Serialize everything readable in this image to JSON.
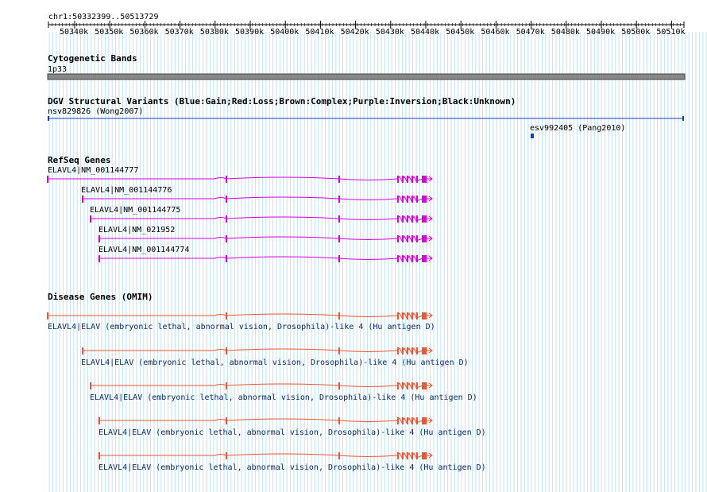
{
  "ruler": {
    "range_label": "chr1:50332399..50513729",
    "ticks": [
      "50340k",
      "50350k",
      "50360k",
      "50370k",
      "50380k",
      "50390k",
      "50400k",
      "50410k",
      "50420k",
      "50430k",
      "50440k",
      "50450k",
      "50460k",
      "50470k",
      "50480k",
      "50490k",
      "50500k",
      "50510k"
    ]
  },
  "cytoband": {
    "title": "Cytogenetic Bands",
    "band": "1p33"
  },
  "dgv": {
    "title": "DGV Structural Variants (Blue:Gain;Red:Loss;Brown:Complex;Purple:Inversion;Black:Unknown)",
    "items": [
      {
        "label": "nsv829826 (Wong2007)"
      },
      {
        "label": "esv992405 (Pang2010)"
      }
    ]
  },
  "refseq": {
    "title": "RefSeq Genes",
    "color": "#dd00dd",
    "transcripts": [
      {
        "label": "ELAVL4|NM_001144777"
      },
      {
        "label": "ELAVL4|NM_001144776"
      },
      {
        "label": "ELAVL4|NM_001144775"
      },
      {
        "label": "ELAVL4|NM_021952"
      },
      {
        "label": "ELAVL4|NM_001144774"
      }
    ]
  },
  "omim": {
    "title": "Disease Genes (OMIM)",
    "color": "#ee5533",
    "genes": [
      {
        "label": "ELAVL4|ELAV (embryonic lethal, abnormal vision, Drosophila)-like 4 (Hu antigen D)"
      },
      {
        "label": "ELAVL4|ELAV (embryonic lethal, abnormal vision, Drosophila)-like 4 (Hu antigen D)"
      },
      {
        "label": "ELAVL4|ELAV (embryonic lethal, abnormal vision, Drosophila)-like 4 (Hu antigen D)"
      },
      {
        "label": "ELAVL4|ELAV (embryonic lethal, abnormal vision, Drosophila)-like 4 (Hu antigen D)"
      },
      {
        "label": "ELAVL4|ELAV (embryonic lethal, abnormal vision, Drosophila)-like 4 (Hu antigen D)"
      }
    ]
  }
}
